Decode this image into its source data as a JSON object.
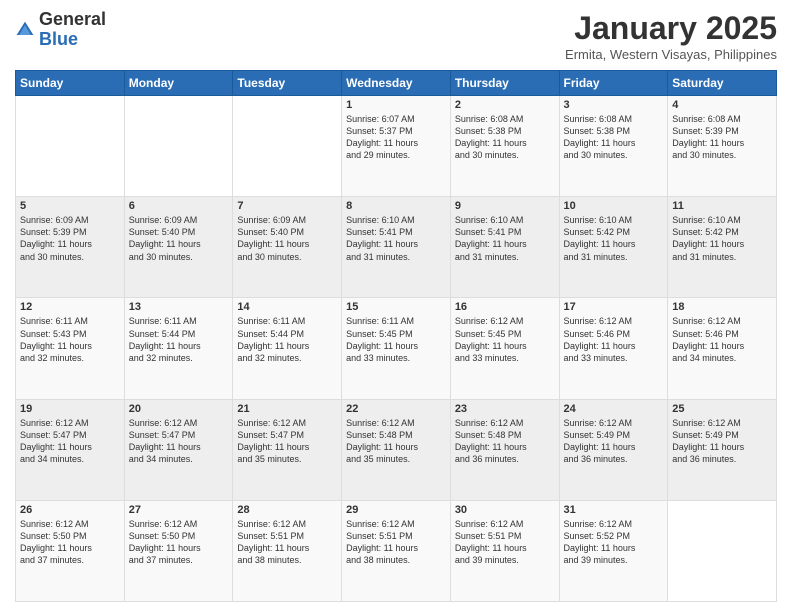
{
  "logo": {
    "general": "General",
    "blue": "Blue"
  },
  "header": {
    "month_title": "January 2025",
    "location": "Ermita, Western Visayas, Philippines"
  },
  "weekdays": [
    "Sunday",
    "Monday",
    "Tuesday",
    "Wednesday",
    "Thursday",
    "Friday",
    "Saturday"
  ],
  "weeks": [
    [
      {
        "day": "",
        "info": ""
      },
      {
        "day": "",
        "info": ""
      },
      {
        "day": "",
        "info": ""
      },
      {
        "day": "1",
        "info": "Sunrise: 6:07 AM\nSunset: 5:37 PM\nDaylight: 11 hours\nand 29 minutes."
      },
      {
        "day": "2",
        "info": "Sunrise: 6:08 AM\nSunset: 5:38 PM\nDaylight: 11 hours\nand 30 minutes."
      },
      {
        "day": "3",
        "info": "Sunrise: 6:08 AM\nSunset: 5:38 PM\nDaylight: 11 hours\nand 30 minutes."
      },
      {
        "day": "4",
        "info": "Sunrise: 6:08 AM\nSunset: 5:39 PM\nDaylight: 11 hours\nand 30 minutes."
      }
    ],
    [
      {
        "day": "5",
        "info": "Sunrise: 6:09 AM\nSunset: 5:39 PM\nDaylight: 11 hours\nand 30 minutes."
      },
      {
        "day": "6",
        "info": "Sunrise: 6:09 AM\nSunset: 5:40 PM\nDaylight: 11 hours\nand 30 minutes."
      },
      {
        "day": "7",
        "info": "Sunrise: 6:09 AM\nSunset: 5:40 PM\nDaylight: 11 hours\nand 30 minutes."
      },
      {
        "day": "8",
        "info": "Sunrise: 6:10 AM\nSunset: 5:41 PM\nDaylight: 11 hours\nand 31 minutes."
      },
      {
        "day": "9",
        "info": "Sunrise: 6:10 AM\nSunset: 5:41 PM\nDaylight: 11 hours\nand 31 minutes."
      },
      {
        "day": "10",
        "info": "Sunrise: 6:10 AM\nSunset: 5:42 PM\nDaylight: 11 hours\nand 31 minutes."
      },
      {
        "day": "11",
        "info": "Sunrise: 6:10 AM\nSunset: 5:42 PM\nDaylight: 11 hours\nand 31 minutes."
      }
    ],
    [
      {
        "day": "12",
        "info": "Sunrise: 6:11 AM\nSunset: 5:43 PM\nDaylight: 11 hours\nand 32 minutes."
      },
      {
        "day": "13",
        "info": "Sunrise: 6:11 AM\nSunset: 5:44 PM\nDaylight: 11 hours\nand 32 minutes."
      },
      {
        "day": "14",
        "info": "Sunrise: 6:11 AM\nSunset: 5:44 PM\nDaylight: 11 hours\nand 32 minutes."
      },
      {
        "day": "15",
        "info": "Sunrise: 6:11 AM\nSunset: 5:45 PM\nDaylight: 11 hours\nand 33 minutes."
      },
      {
        "day": "16",
        "info": "Sunrise: 6:12 AM\nSunset: 5:45 PM\nDaylight: 11 hours\nand 33 minutes."
      },
      {
        "day": "17",
        "info": "Sunrise: 6:12 AM\nSunset: 5:46 PM\nDaylight: 11 hours\nand 33 minutes."
      },
      {
        "day": "18",
        "info": "Sunrise: 6:12 AM\nSunset: 5:46 PM\nDaylight: 11 hours\nand 34 minutes."
      }
    ],
    [
      {
        "day": "19",
        "info": "Sunrise: 6:12 AM\nSunset: 5:47 PM\nDaylight: 11 hours\nand 34 minutes."
      },
      {
        "day": "20",
        "info": "Sunrise: 6:12 AM\nSunset: 5:47 PM\nDaylight: 11 hours\nand 34 minutes."
      },
      {
        "day": "21",
        "info": "Sunrise: 6:12 AM\nSunset: 5:47 PM\nDaylight: 11 hours\nand 35 minutes."
      },
      {
        "day": "22",
        "info": "Sunrise: 6:12 AM\nSunset: 5:48 PM\nDaylight: 11 hours\nand 35 minutes."
      },
      {
        "day": "23",
        "info": "Sunrise: 6:12 AM\nSunset: 5:48 PM\nDaylight: 11 hours\nand 36 minutes."
      },
      {
        "day": "24",
        "info": "Sunrise: 6:12 AM\nSunset: 5:49 PM\nDaylight: 11 hours\nand 36 minutes."
      },
      {
        "day": "25",
        "info": "Sunrise: 6:12 AM\nSunset: 5:49 PM\nDaylight: 11 hours\nand 36 minutes."
      }
    ],
    [
      {
        "day": "26",
        "info": "Sunrise: 6:12 AM\nSunset: 5:50 PM\nDaylight: 11 hours\nand 37 minutes."
      },
      {
        "day": "27",
        "info": "Sunrise: 6:12 AM\nSunset: 5:50 PM\nDaylight: 11 hours\nand 37 minutes."
      },
      {
        "day": "28",
        "info": "Sunrise: 6:12 AM\nSunset: 5:51 PM\nDaylight: 11 hours\nand 38 minutes."
      },
      {
        "day": "29",
        "info": "Sunrise: 6:12 AM\nSunset: 5:51 PM\nDaylight: 11 hours\nand 38 minutes."
      },
      {
        "day": "30",
        "info": "Sunrise: 6:12 AM\nSunset: 5:51 PM\nDaylight: 11 hours\nand 39 minutes."
      },
      {
        "day": "31",
        "info": "Sunrise: 6:12 AM\nSunset: 5:52 PM\nDaylight: 11 hours\nand 39 minutes."
      },
      {
        "day": "",
        "info": ""
      }
    ]
  ]
}
